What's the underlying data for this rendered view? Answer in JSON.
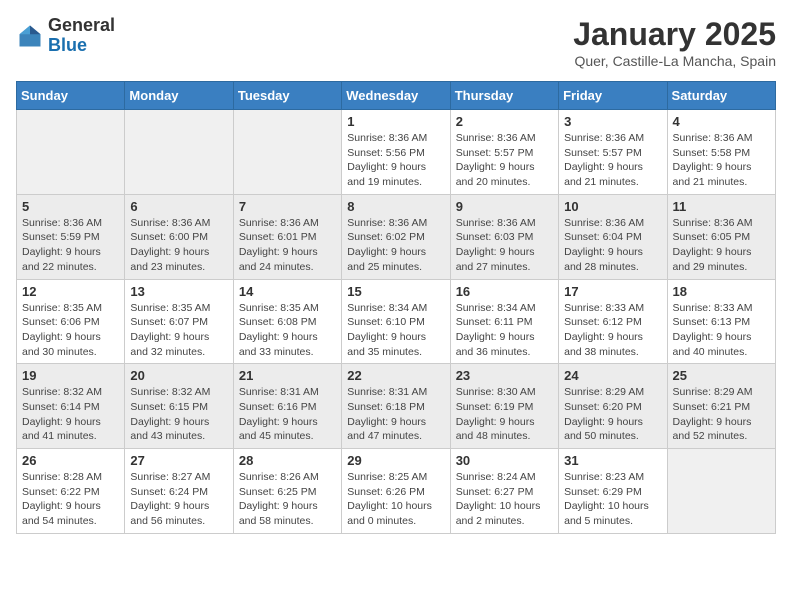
{
  "header": {
    "logo_line1": "General",
    "logo_line2": "Blue",
    "month_title": "January 2025",
    "location": "Quer, Castille-La Mancha, Spain"
  },
  "days_of_week": [
    "Sunday",
    "Monday",
    "Tuesday",
    "Wednesday",
    "Thursday",
    "Friday",
    "Saturday"
  ],
  "weeks": [
    [
      {
        "day": null
      },
      {
        "day": null
      },
      {
        "day": null
      },
      {
        "day": "1",
        "sunrise": "8:36 AM",
        "sunset": "5:56 PM",
        "daylight": "9 hours and 19 minutes."
      },
      {
        "day": "2",
        "sunrise": "8:36 AM",
        "sunset": "5:57 PM",
        "daylight": "9 hours and 20 minutes."
      },
      {
        "day": "3",
        "sunrise": "8:36 AM",
        "sunset": "5:57 PM",
        "daylight": "9 hours and 21 minutes."
      },
      {
        "day": "4",
        "sunrise": "8:36 AM",
        "sunset": "5:58 PM",
        "daylight": "9 hours and 21 minutes."
      }
    ],
    [
      {
        "day": "5",
        "sunrise": "8:36 AM",
        "sunset": "5:59 PM",
        "daylight": "9 hours and 22 minutes."
      },
      {
        "day": "6",
        "sunrise": "8:36 AM",
        "sunset": "6:00 PM",
        "daylight": "9 hours and 23 minutes."
      },
      {
        "day": "7",
        "sunrise": "8:36 AM",
        "sunset": "6:01 PM",
        "daylight": "9 hours and 24 minutes."
      },
      {
        "day": "8",
        "sunrise": "8:36 AM",
        "sunset": "6:02 PM",
        "daylight": "9 hours and 25 minutes."
      },
      {
        "day": "9",
        "sunrise": "8:36 AM",
        "sunset": "6:03 PM",
        "daylight": "9 hours and 27 minutes."
      },
      {
        "day": "10",
        "sunrise": "8:36 AM",
        "sunset": "6:04 PM",
        "daylight": "9 hours and 28 minutes."
      },
      {
        "day": "11",
        "sunrise": "8:36 AM",
        "sunset": "6:05 PM",
        "daylight": "9 hours and 29 minutes."
      }
    ],
    [
      {
        "day": "12",
        "sunrise": "8:35 AM",
        "sunset": "6:06 PM",
        "daylight": "9 hours and 30 minutes."
      },
      {
        "day": "13",
        "sunrise": "8:35 AM",
        "sunset": "6:07 PM",
        "daylight": "9 hours and 32 minutes."
      },
      {
        "day": "14",
        "sunrise": "8:35 AM",
        "sunset": "6:08 PM",
        "daylight": "9 hours and 33 minutes."
      },
      {
        "day": "15",
        "sunrise": "8:34 AM",
        "sunset": "6:10 PM",
        "daylight": "9 hours and 35 minutes."
      },
      {
        "day": "16",
        "sunrise": "8:34 AM",
        "sunset": "6:11 PM",
        "daylight": "9 hours and 36 minutes."
      },
      {
        "day": "17",
        "sunrise": "8:33 AM",
        "sunset": "6:12 PM",
        "daylight": "9 hours and 38 minutes."
      },
      {
        "day": "18",
        "sunrise": "8:33 AM",
        "sunset": "6:13 PM",
        "daylight": "9 hours and 40 minutes."
      }
    ],
    [
      {
        "day": "19",
        "sunrise": "8:32 AM",
        "sunset": "6:14 PM",
        "daylight": "9 hours and 41 minutes."
      },
      {
        "day": "20",
        "sunrise": "8:32 AM",
        "sunset": "6:15 PM",
        "daylight": "9 hours and 43 minutes."
      },
      {
        "day": "21",
        "sunrise": "8:31 AM",
        "sunset": "6:16 PM",
        "daylight": "9 hours and 45 minutes."
      },
      {
        "day": "22",
        "sunrise": "8:31 AM",
        "sunset": "6:18 PM",
        "daylight": "9 hours and 47 minutes."
      },
      {
        "day": "23",
        "sunrise": "8:30 AM",
        "sunset": "6:19 PM",
        "daylight": "9 hours and 48 minutes."
      },
      {
        "day": "24",
        "sunrise": "8:29 AM",
        "sunset": "6:20 PM",
        "daylight": "9 hours and 50 minutes."
      },
      {
        "day": "25",
        "sunrise": "8:29 AM",
        "sunset": "6:21 PM",
        "daylight": "9 hours and 52 minutes."
      }
    ],
    [
      {
        "day": "26",
        "sunrise": "8:28 AM",
        "sunset": "6:22 PM",
        "daylight": "9 hours and 54 minutes."
      },
      {
        "day": "27",
        "sunrise": "8:27 AM",
        "sunset": "6:24 PM",
        "daylight": "9 hours and 56 minutes."
      },
      {
        "day": "28",
        "sunrise": "8:26 AM",
        "sunset": "6:25 PM",
        "daylight": "9 hours and 58 minutes."
      },
      {
        "day": "29",
        "sunrise": "8:25 AM",
        "sunset": "6:26 PM",
        "daylight": "10 hours and 0 minutes."
      },
      {
        "day": "30",
        "sunrise": "8:24 AM",
        "sunset": "6:27 PM",
        "daylight": "10 hours and 2 minutes."
      },
      {
        "day": "31",
        "sunrise": "8:23 AM",
        "sunset": "6:29 PM",
        "daylight": "10 hours and 5 minutes."
      },
      {
        "day": null
      }
    ]
  ],
  "labels": {
    "sunrise": "Sunrise:",
    "sunset": "Sunset:",
    "daylight": "Daylight:"
  }
}
